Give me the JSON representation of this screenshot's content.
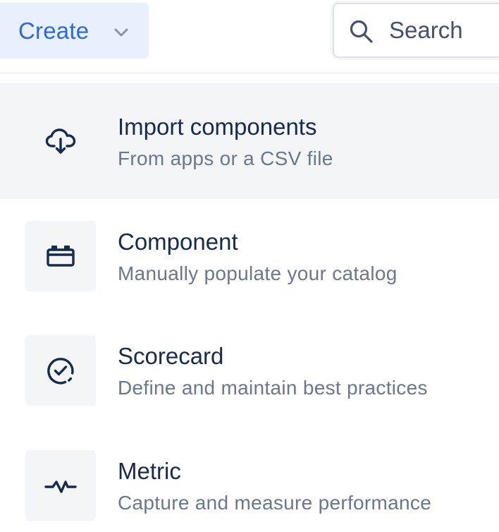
{
  "header": {
    "create_label": "Create",
    "create_icon": "chevron-down-icon",
    "search_icon": "search-icon",
    "search_placeholder": "Search",
    "accent_color": "#2f6ad9",
    "create_bg": "#e9f0fd"
  },
  "menu": {
    "items": [
      {
        "title": "Import components",
        "description": "From apps or a CSV file",
        "icon": "cloud-download-icon",
        "highlighted": true
      },
      {
        "title": "Component",
        "description": "Manually populate your catalog",
        "icon": "component-icon",
        "highlighted": false
      },
      {
        "title": "Scorecard",
        "description": "Define and maintain best practices",
        "icon": "scorecard-check-icon",
        "highlighted": false
      },
      {
        "title": "Metric",
        "description": "Capture and measure performance",
        "icon": "pulse-line-icon",
        "highlighted": false
      }
    ]
  },
  "colors": {
    "text_primary": "#172b4d",
    "text_secondary": "#6b778c",
    "hover_bg": "#f4f5f7",
    "icon_box_bg": "#f4f5f7",
    "border": "#dfe1e6"
  }
}
